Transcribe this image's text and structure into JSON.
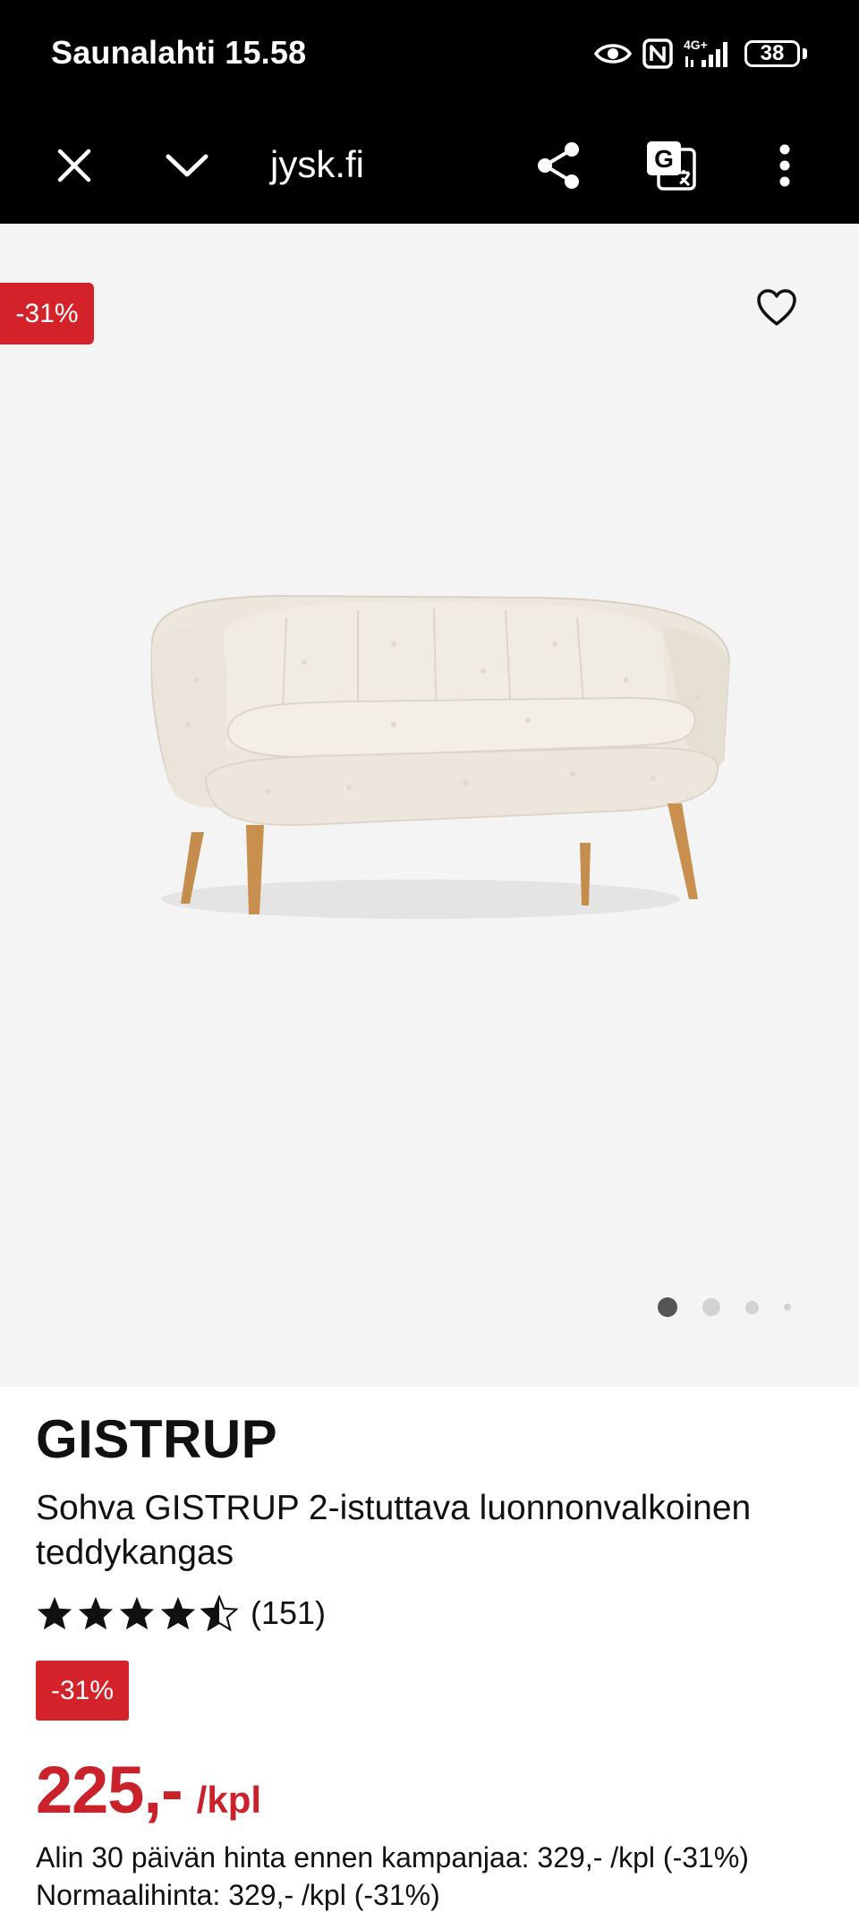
{
  "status_bar": {
    "carrier_time": "Saunalahti 15.58",
    "network": "4G+",
    "battery": "38"
  },
  "toolbar": {
    "url": "jysk.fi"
  },
  "gallery": {
    "discount_badge": "-31%",
    "image_alt": "Sohva GISTRUP 2-istuttava luonnonvalkoinen teddykangas",
    "dots": 4,
    "active_dot": 0
  },
  "product": {
    "brand": "GISTRUP",
    "name": "Sohva GISTRUP 2-istuttava luonnonvalkoinen teddykangas",
    "rating": 4.5,
    "rating_max": 5,
    "review_count": "(151)",
    "discount_badge": "-31%",
    "price": "225,-",
    "price_unit": "/kpl",
    "lowest_price_note": "Alin 30 päivän hinta ennen kampanjaa: 329,- /kpl (-31%)",
    "normal_price_note": "Normaalihinta: 329,- /kpl (-31%)"
  },
  "colors": {
    "accent_red": "#d3222a",
    "price_red": "#c9222a",
    "image_bg": "#f4f4f4"
  }
}
